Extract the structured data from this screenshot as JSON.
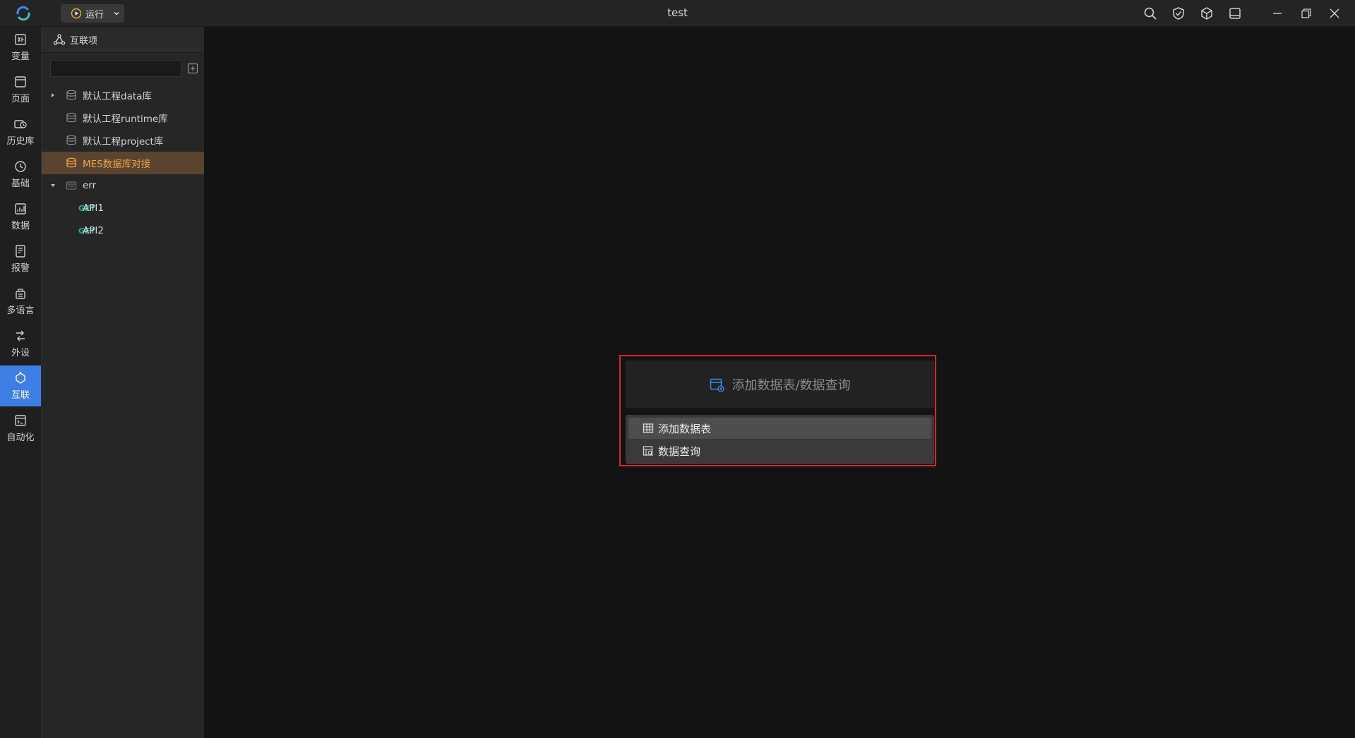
{
  "titlebar": {
    "title": "test",
    "run_label": "运行",
    "icons": [
      "search-icon",
      "shield-check-icon",
      "cube-icon",
      "panel-layout-icon",
      "minimize-icon",
      "restore-icon",
      "close-icon"
    ]
  },
  "colors": {
    "accent": "#3d7fe6",
    "selected_bg": "#5a4430",
    "selected_text": "#f0a548",
    "method_get": "#1fb59a",
    "highlight_border": "#d9242c"
  },
  "nav": {
    "items": [
      {
        "label": "变量",
        "icon": "variable-icon"
      },
      {
        "label": "页面",
        "icon": "page-icon"
      },
      {
        "label": "历史库",
        "icon": "history-db-icon"
      },
      {
        "label": "基础",
        "icon": "basic-icon"
      },
      {
        "label": "数据",
        "icon": "data-icon"
      },
      {
        "label": "报警",
        "icon": "alarm-icon"
      },
      {
        "label": "多语言",
        "icon": "language-icon"
      },
      {
        "label": "外设",
        "icon": "peripheral-icon"
      },
      {
        "label": "互联",
        "icon": "interconnect-icon",
        "active": true
      },
      {
        "label": "自动化",
        "icon": "automation-icon"
      }
    ]
  },
  "tree": {
    "header": "互联项",
    "search_value": "",
    "items": [
      {
        "label": "默认工程data库",
        "icon": "database-icon",
        "expandable": true
      },
      {
        "label": "默认工程runtime库",
        "icon": "database-icon"
      },
      {
        "label": "默认工程project库",
        "icon": "database-icon"
      },
      {
        "label": "MES数据库对接",
        "icon": "database-icon",
        "selected": true
      },
      {
        "label": "err",
        "icon": "api-group-icon",
        "expanded": true
      },
      {
        "method": "GET",
        "label": "API1"
      },
      {
        "method": "GET",
        "label": "API2"
      }
    ]
  },
  "main": {
    "add_card_label": "添加数据表/数据查询",
    "dropdown": [
      {
        "label": "添加数据表",
        "icon": "table-icon"
      },
      {
        "label": "数据查询",
        "icon": "query-icon"
      }
    ]
  }
}
